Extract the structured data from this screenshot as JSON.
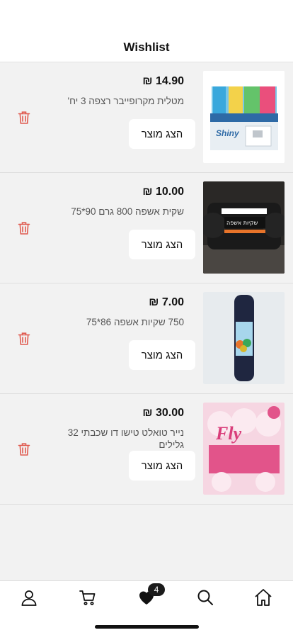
{
  "header": {
    "title": "Wishlist"
  },
  "colors": {
    "accent": "#e05a4f",
    "text": "#111111",
    "background": "#f2f2f2"
  },
  "items": [
    {
      "price": "₪ 14.90",
      "name": "מטלית מקרופייבר רצפה 3 יח'",
      "button": "הצג מוצר",
      "image_label": "Shiny"
    },
    {
      "price": "₪ 10.00",
      "name": "שקית אשפה 800 גרם 90*75",
      "button": "הצג מוצר",
      "image_label": "שקיות אשפה"
    },
    {
      "price": "₪ 7.00",
      "name": "750 שקיות אשפה 86*75",
      "button": "הצג מוצר",
      "image_label": ""
    },
    {
      "price": "₪ 30.00",
      "name": "נייר טואלט טישו דו שכבתי 32 גלילים",
      "button": "הצג מוצר",
      "image_label": "Fly"
    }
  ],
  "tabbar": {
    "tabs": [
      {
        "icon": "user-icon"
      },
      {
        "icon": "cart-icon"
      },
      {
        "icon": "heart-icon"
      },
      {
        "icon": "search-icon"
      },
      {
        "icon": "home-icon"
      }
    ],
    "wishlist_count": "4"
  }
}
